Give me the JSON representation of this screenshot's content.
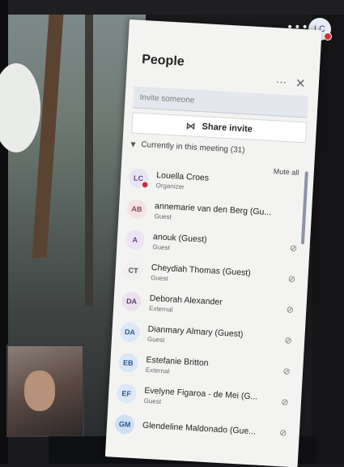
{
  "top": {
    "more_icon": "more-horizontal-icon",
    "me_initials": "LC"
  },
  "panel": {
    "title": "People",
    "more_icon": "more-horizontal-icon",
    "close_icon": "close-icon"
  },
  "invite": {
    "placeholder": "Invite someone"
  },
  "share": {
    "label": "Share invite",
    "icon": "share-icon"
  },
  "section": {
    "label": "Currently in this meeting (31)",
    "mute_all": "Mute all"
  },
  "participants": [
    {
      "initials": "LC",
      "name": "Louella Croes",
      "role": "Organizer",
      "avatar_bg": "#e9e4f2",
      "avatar_fg": "#5b4f8a",
      "presence": true,
      "muted": false
    },
    {
      "initials": "AB",
      "name": "annemarie van den Berg (Gu...",
      "role": "Guest",
      "avatar_bg": "#f4e2e6",
      "avatar_fg": "#8a3f55",
      "presence": false,
      "muted": false
    },
    {
      "initials": "A",
      "name": "anouk (Guest)",
      "role": "Guest",
      "avatar_bg": "#eee4f5",
      "avatar_fg": "#6a3f8a",
      "presence": false,
      "muted": true
    },
    {
      "initials": "CT",
      "name": "Cheydiah Thomas (Guest)",
      "role": "Guest",
      "avatar_bg": "#efefef",
      "avatar_fg": "#4a4a4a",
      "presence": false,
      "muted": true
    },
    {
      "initials": "DA",
      "name": "Deborah Alexander",
      "role": "External",
      "avatar_bg": "#ece2ef",
      "avatar_fg": "#5d3f6a",
      "presence": false,
      "muted": true
    },
    {
      "initials": "DA",
      "name": "Dianmary Almary (Guest)",
      "role": "Guest",
      "avatar_bg": "#dce8f6",
      "avatar_fg": "#2f5b8a",
      "presence": false,
      "muted": true
    },
    {
      "initials": "EB",
      "name": "Estefanie Britton",
      "role": "External",
      "avatar_bg": "#dbe7f5",
      "avatar_fg": "#2c5a8c",
      "presence": false,
      "muted": true
    },
    {
      "initials": "EF",
      "name": "Evelyne Figaroa - de Mei (G...",
      "role": "Guest",
      "avatar_bg": "#dce8f6",
      "avatar_fg": "#2f5b8a",
      "presence": false,
      "muted": true
    },
    {
      "initials": "GM",
      "name": "Glendeline Maldonado (Gue...",
      "role": "",
      "avatar_bg": "#cfe0f3",
      "avatar_fg": "#2a5a8f",
      "presence": false,
      "muted": true
    }
  ],
  "icons": {
    "mic_off": "mic-off-icon"
  }
}
